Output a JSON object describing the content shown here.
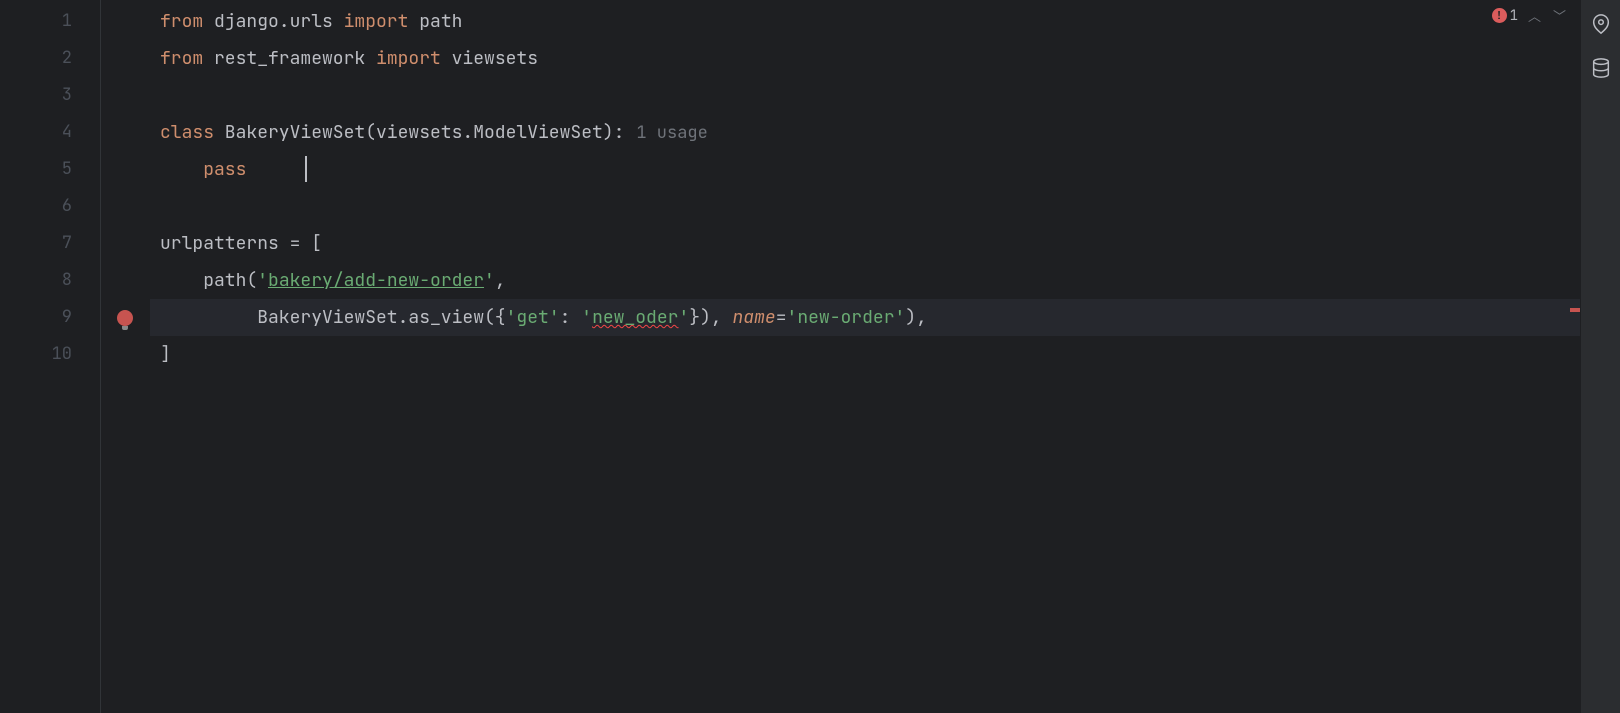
{
  "gutter": {
    "lines": [
      "1",
      "2",
      "3",
      "4",
      "5",
      "6",
      "7",
      "8",
      "9",
      "10"
    ]
  },
  "errors": {
    "count": "1"
  },
  "code": {
    "l1": {
      "kw1": "from",
      "mod": " django.urls ",
      "kw2": "import",
      "tgt": " path"
    },
    "l2": {
      "kw1": "from",
      "mod": " rest_framework ",
      "kw2": "import",
      "tgt": " viewsets"
    },
    "l3": "",
    "l4": {
      "kw": "class",
      "name": " BakeryViewSet(viewsets.ModelViewSet):",
      "hint": "1 usage"
    },
    "l5": {
      "indent": "    ",
      "kw": "pass"
    },
    "l6": "",
    "l7": "urlpatterns = [",
    "l8": {
      "indent": "    ",
      "fn": "path(",
      "q": "'",
      "url": "bakery/add-new-order",
      "q2": "'",
      "end": ","
    },
    "l9": {
      "indent": "         ",
      "cls": "BakeryViewSet.as_view({",
      "q1": "'",
      "k": "get",
      "q2": "'",
      "colon": ": ",
      "q3": "'",
      "typo": "new_oder",
      "q4": "'",
      "close": "}), ",
      "param": "name",
      "eq": "=",
      "q5": "'",
      "val": "new-order",
      "q6": "'",
      "end": "),"
    },
    "l10": "]"
  }
}
